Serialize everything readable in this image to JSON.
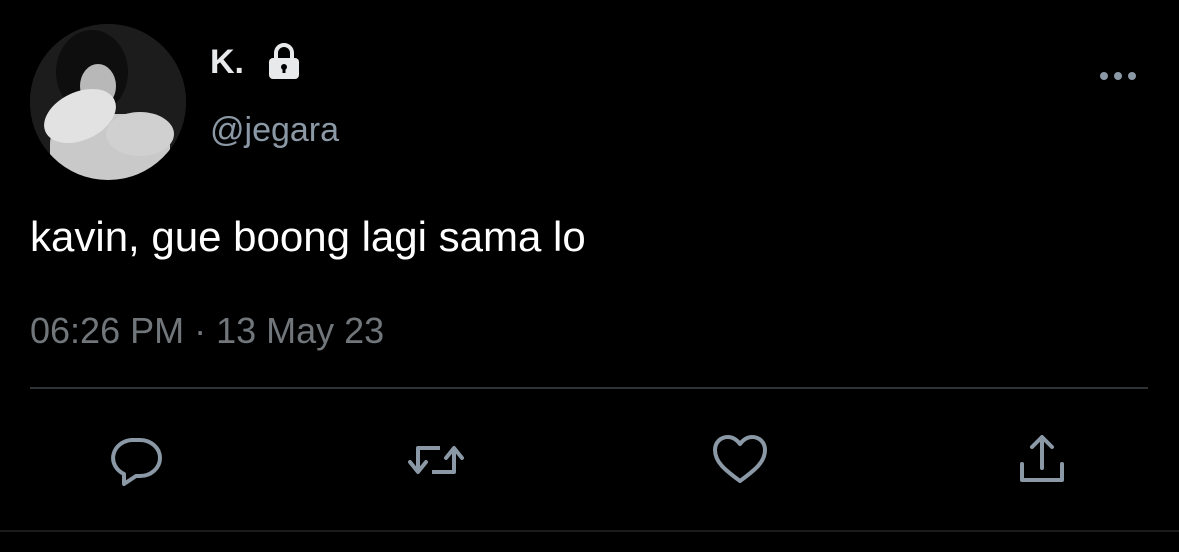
{
  "tweet": {
    "display_name": "K.",
    "handle": "@jegara",
    "text": "kavin, gue boong lagi sama lo",
    "timestamp": "06:26 PM · 13 May 23"
  },
  "icons": {
    "lock": "lock-icon",
    "more": "more-horizontal-icon",
    "reply": "speech-bubble-icon",
    "retweet": "retweet-arrows-icon",
    "like": "heart-icon",
    "share": "upload-share-icon"
  },
  "colors": {
    "background": "#000000",
    "primary_text": "#e7e9ea",
    "secondary_text": "#71767b",
    "icon": "#8b98a5",
    "divider": "#2f3336"
  }
}
